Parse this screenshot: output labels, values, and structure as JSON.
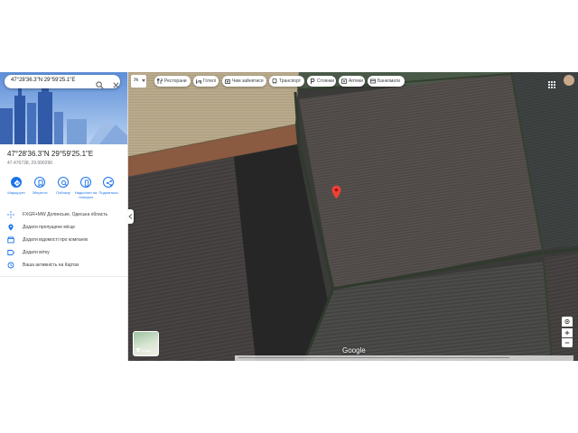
{
  "search": {
    "value": "47°28'36.3\"N 29°59'25.1\"E"
  },
  "place": {
    "title": "47°28'36.3\"N 29°59'25.1\"E",
    "subtitle": "47.476738, 29.990296"
  },
  "actions": [
    {
      "label": "Маршрути",
      "icon": "directions-icon"
    },
    {
      "label": "Зберегти",
      "icon": "bookmark-icon"
    },
    {
      "label": "Поблизу",
      "icon": "nearby-icon"
    },
    {
      "label": "Надіслати на телефон",
      "icon": "phone-icon"
    },
    {
      "label": "Поділитися",
      "icon": "share-icon"
    }
  ],
  "info_rows": [
    {
      "text": "FXGR+MW Долинське, Одеська область",
      "icon": "plus-code-icon"
    },
    {
      "text": "Додати пропущене місце",
      "icon": "add-place-icon"
    },
    {
      "text": "Додати відомості про компанію",
      "icon": "business-icon"
    },
    {
      "text": "Додати мітку",
      "icon": "label-icon"
    },
    {
      "text": "Ваша активність на Картах",
      "icon": "history-icon"
    }
  ],
  "map": {
    "language": "Ук",
    "chips": [
      {
        "label": "Ресторани",
        "icon": "restaurant-icon"
      },
      {
        "label": "Готелі",
        "icon": "hotel-icon"
      },
      {
        "label": "Чим зайнятися",
        "icon": "camera-icon"
      },
      {
        "label": "Транспорт",
        "icon": "transit-icon"
      },
      {
        "label": "Стоянки",
        "icon": "parking-icon"
      },
      {
        "label": "Аптеки",
        "icon": "pharmacy-icon"
      },
      {
        "label": "Банкомати",
        "icon": "atm-icon"
      }
    ],
    "layers_label": "Шари",
    "logo": "Google"
  },
  "colors": {
    "accent": "#1a73e8",
    "pin": "#ea4335"
  }
}
